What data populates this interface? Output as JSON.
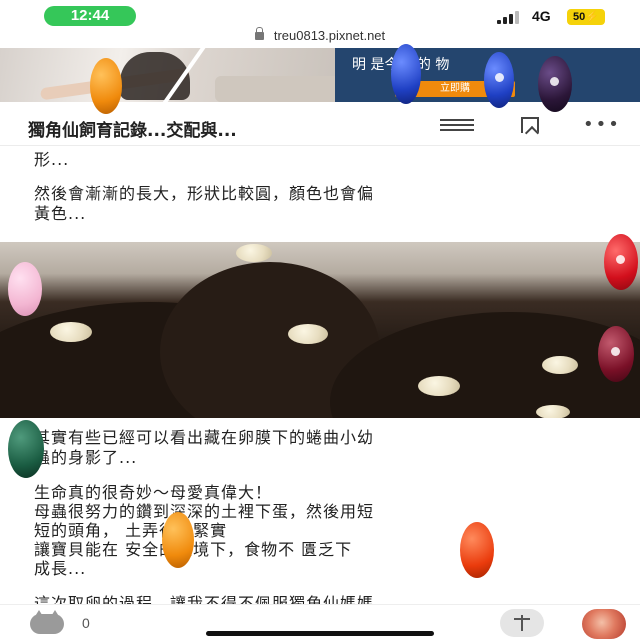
{
  "status_bar": {
    "time": "12:44",
    "network": "4G",
    "battery": "50"
  },
  "browser": {
    "url": "treu0813.pixnet.net"
  },
  "ad": {
    "headline": "明   是今年   的   物",
    "cta": "立即購"
  },
  "nav": {
    "title": "獨角仙飼育記錄...交配與..."
  },
  "article": {
    "p1": "形...",
    "p2_line1": "然後會漸漸的長大，形狀比較圓，顏色也會偏",
    "p2_line2": "黃色...",
    "p3_line1": "其實有些已經可以看出藏在卵膜下的蜷曲小幼",
    "p3_line2": "蟲的身影了...",
    "p4_line1": "生命真的很奇妙～母愛真偉大！",
    "p4_line2": "母蟲很努力的鑽到深深的土裡下蛋，然後用短",
    "p4_line3": "短的頭角，  土弄得很緊實",
    "p4_line4": "讓寶貝能在   安全的環境下，食物不  匱乏下",
    "p4_line5": "成長...",
    "p5_line1": "這次取卵的過程，讓我不得不佩服獨角仙媽媽"
  },
  "bottom_bar": {
    "like_count": "0"
  },
  "icons": [
    "lock-icon",
    "menu-icon",
    "bookmark-icon",
    "more-icon",
    "cat-icon",
    "share-icon"
  ],
  "colors": {
    "time_pill": "#35c759",
    "battery": "#f5d20a",
    "ad_background": "#24456e",
    "ad_cta": "#f08a0c"
  }
}
